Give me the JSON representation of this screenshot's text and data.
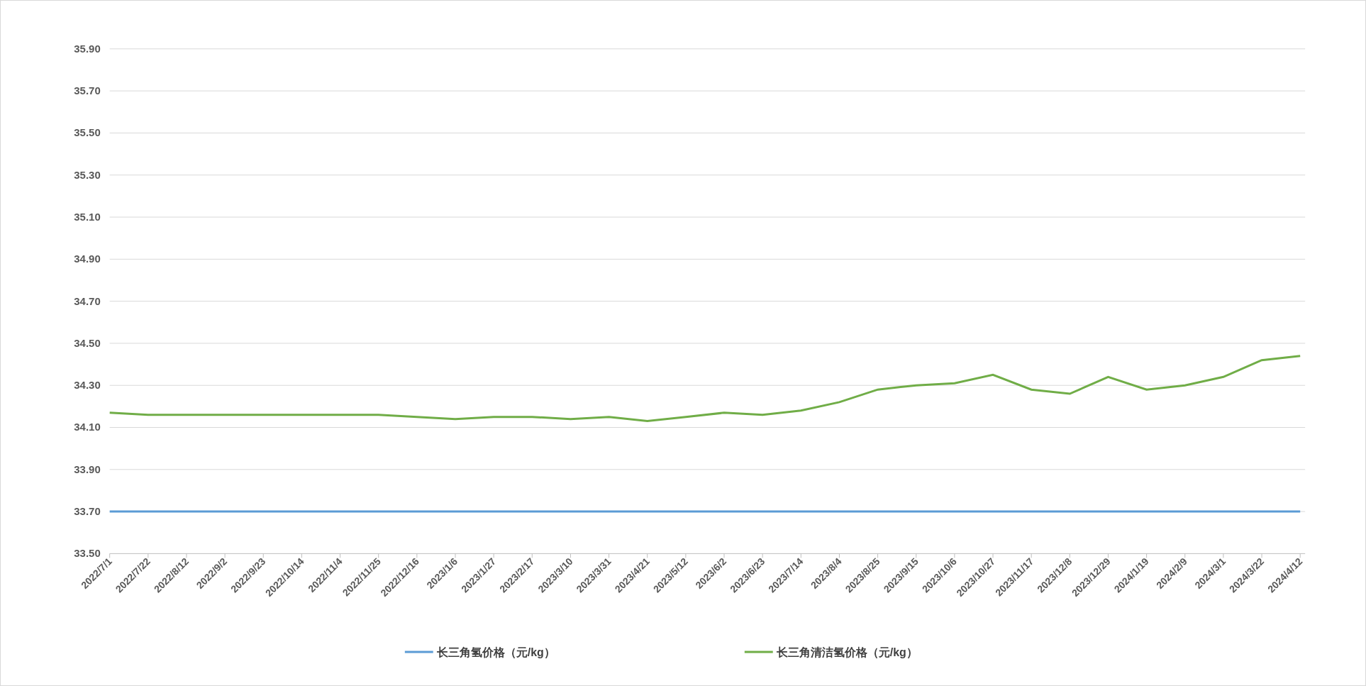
{
  "chart_data": {
    "type": "line",
    "x": [
      "2022/7/1",
      "2022/7/22",
      "2022/8/12",
      "2022/9/2",
      "2022/9/23",
      "2022/10/14",
      "2022/11/4",
      "2022/11/25",
      "2022/12/16",
      "2023/1/6",
      "2023/1/27",
      "2023/2/17",
      "2023/3/10",
      "2023/3/31",
      "2023/4/21",
      "2023/5/12",
      "2023/6/2",
      "2023/6/23",
      "2023/7/14",
      "2023/8/4",
      "2023/8/25",
      "2023/9/15",
      "2023/10/6",
      "2023/10/27",
      "2023/11/17",
      "2023/12/8",
      "2023/12/29",
      "2024/1/19",
      "2024/2/9",
      "2024/3/1",
      "2024/3/22",
      "2024/4/12"
    ],
    "series": [
      {
        "name": "长三角氢价格（元/kg）",
        "color": "#5b9bd5",
        "values": [
          33.7,
          33.7,
          33.7,
          33.7,
          33.7,
          33.7,
          33.7,
          33.7,
          33.7,
          33.7,
          33.7,
          33.7,
          33.7,
          33.7,
          33.7,
          33.7,
          33.7,
          33.7,
          33.7,
          33.7,
          33.7,
          33.7,
          33.7,
          33.7,
          33.7,
          33.7,
          33.7,
          33.7,
          33.7,
          33.7,
          33.7,
          33.7
        ]
      },
      {
        "name": "长三角清洁氢价格（元/kg）",
        "color": "#70ad47",
        "values": [
          34.17,
          34.16,
          34.16,
          34.16,
          34.16,
          34.16,
          34.16,
          34.16,
          34.15,
          34.14,
          34.15,
          34.15,
          34.14,
          34.15,
          34.13,
          34.15,
          34.17,
          34.16,
          34.18,
          34.22,
          34.28,
          34.3,
          34.31,
          34.35,
          34.28,
          34.26,
          34.34,
          34.28,
          34.3,
          34.34,
          34.42,
          34.44
        ]
      }
    ],
    "ylim": [
      33.5,
      35.9
    ],
    "grid": true,
    "legend": true,
    "yticks": [
      {
        "value": 33.5,
        "label": "33.50"
      },
      {
        "value": 33.7,
        "label": "33.70"
      },
      {
        "value": 33.9,
        "label": "33.90"
      },
      {
        "value": 34.1,
        "label": "34.10"
      },
      {
        "value": 34.3,
        "label": "34.30"
      },
      {
        "value": 34.5,
        "label": "34.50"
      },
      {
        "value": 34.7,
        "label": "34.70"
      },
      {
        "value": 34.9,
        "label": "34.90"
      },
      {
        "value": 35.1,
        "label": "35.10"
      },
      {
        "value": 35.3,
        "label": "35.30"
      },
      {
        "value": 35.5,
        "label": "35.50"
      },
      {
        "value": 35.7,
        "label": "35.70"
      },
      {
        "value": 35.9,
        "label": "35.90"
      }
    ]
  }
}
